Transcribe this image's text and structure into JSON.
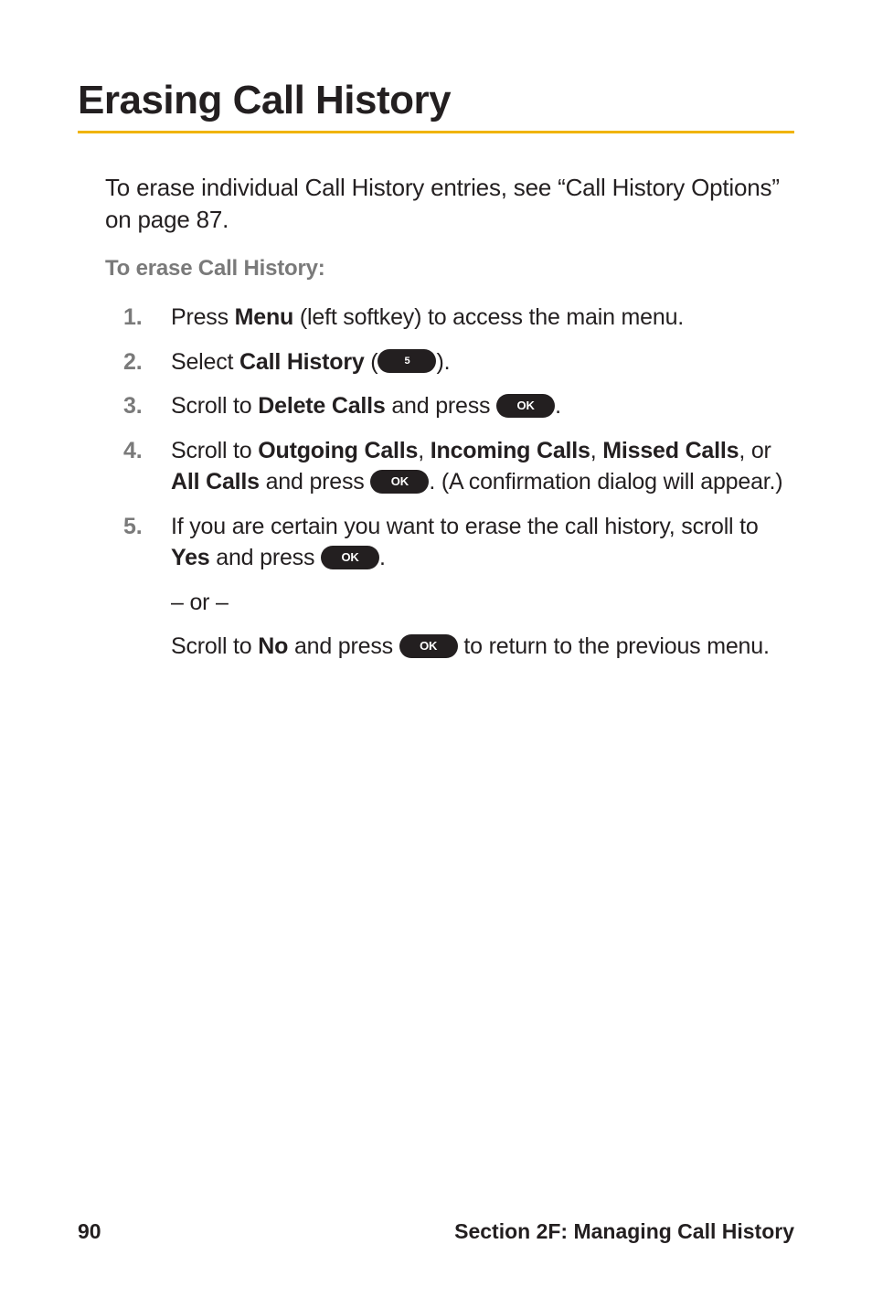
{
  "title": "Erasing Call History",
  "intro": "To erase individual Call History entries, see “Call History Options” on page 87.",
  "subhead": "To erase Call History:",
  "steps": {
    "s1": {
      "num": "1.",
      "a": "Press ",
      "menu": "Menu",
      "b": " (left softkey) to access the main menu."
    },
    "s2": {
      "num": "2.",
      "a": "Select ",
      "ch": "Call History",
      "b": " (",
      "key": "5",
      "c": ")."
    },
    "s3": {
      "num": "3.",
      "a": "Scroll to ",
      "dc": "Delete Calls",
      "b": " and press ",
      "key": "OK",
      "c": "."
    },
    "s4": {
      "num": "4.",
      "a": "Scroll to ",
      "og": "Outgoing Calls",
      "b": ", ",
      "ic": "Incoming Calls",
      "c": ", ",
      "mc": "Missed Calls",
      "d": ", or ",
      "ac": "All Calls",
      "e": " and press ",
      "key": "OK",
      "f": ". (A confirmation dialog will appear.)"
    },
    "s5": {
      "num": "5.",
      "a": "If you are certain you want to erase the call history, scroll to ",
      "yes": "Yes",
      "b": " and press ",
      "key": "OK",
      "c": ".",
      "or": "– or –",
      "d": "Scroll to ",
      "no": "No",
      "e": " and press ",
      "key2": "OK",
      "f": " to return to the previous menu."
    }
  },
  "footer": {
    "page": "90",
    "section": "Section 2F: Managing Call History"
  }
}
